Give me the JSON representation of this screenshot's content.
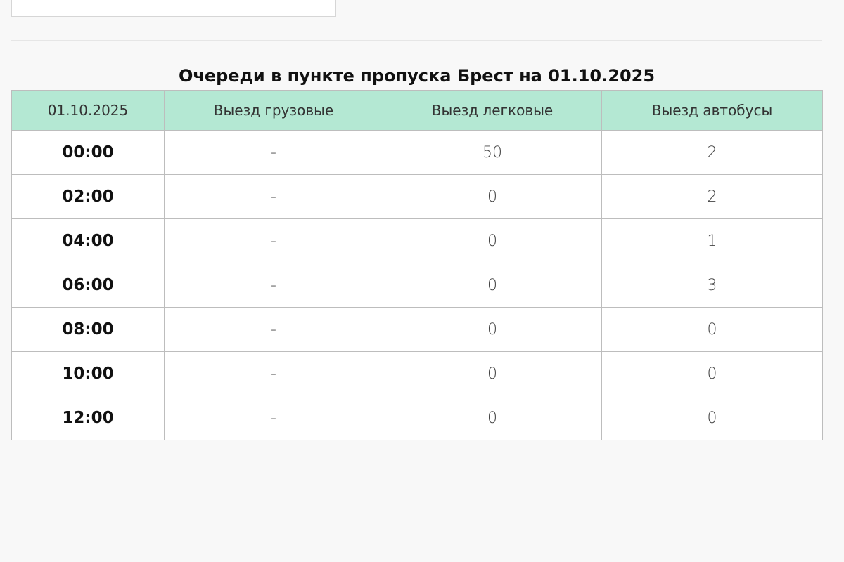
{
  "title": "Очереди в пункте пропуска Брест на 01.10.2025",
  "table": {
    "headers": [
      "01.10.2025",
      "Выезд грузовые",
      "Выезд легковые",
      "Выезд автобусы"
    ],
    "rows": [
      {
        "time": "00:00",
        "trucks": "-",
        "cars": "50",
        "buses": "2"
      },
      {
        "time": "02:00",
        "trucks": "-",
        "cars": "0",
        "buses": "2"
      },
      {
        "time": "04:00",
        "trucks": "-",
        "cars": "0",
        "buses": "1"
      },
      {
        "time": "06:00",
        "trucks": "-",
        "cars": "0",
        "buses": "3"
      },
      {
        "time": "08:00",
        "trucks": "-",
        "cars": "0",
        "buses": "0"
      },
      {
        "time": "10:00",
        "trucks": "-",
        "cars": "0",
        "buses": "0"
      },
      {
        "time": "12:00",
        "trucks": "-",
        "cars": "0",
        "buses": "0"
      }
    ]
  },
  "colors": {
    "header_bg": "#b4e8d3",
    "border": "#bdbdbd",
    "page_bg": "#f8f8f8"
  }
}
